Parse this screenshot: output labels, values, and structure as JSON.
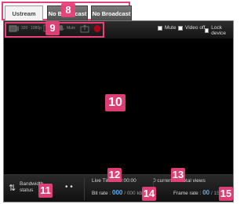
{
  "tabs": [
    {
      "label": "Ustream"
    },
    {
      "label": "No Broadcast"
    },
    {
      "label": "No Broadcast"
    }
  ],
  "toolbar": {
    "items": [
      {
        "label": "320"
      },
      {
        "label": "1080p"
      },
      {
        "label": "Mute"
      }
    ],
    "options": [
      {
        "label": "Mute",
        "checked": false
      },
      {
        "label": "Video off",
        "checked": false
      },
      {
        "label": "Lock device",
        "checked": false
      }
    ]
  },
  "footer": {
    "bandwidth_label": "Bandwidth\nstatus",
    "live_time_label": "Live Time:",
    "live_time_value": "00:00:00",
    "views_text": "0 current / 0 total views",
    "bitrate_label": "Bit rate :",
    "bitrate_value": "000",
    "bitrate_max": "/ 000 kbps",
    "framerate_label": "Frame rate :",
    "framerate_value": "00",
    "framerate_max": "/ 15"
  },
  "callouts": [
    "8",
    "9",
    "10",
    "11",
    "12",
    "13",
    "14",
    "15"
  ],
  "colors": {
    "callout": "#e8417a",
    "value_blue": "#5fa9e8"
  }
}
